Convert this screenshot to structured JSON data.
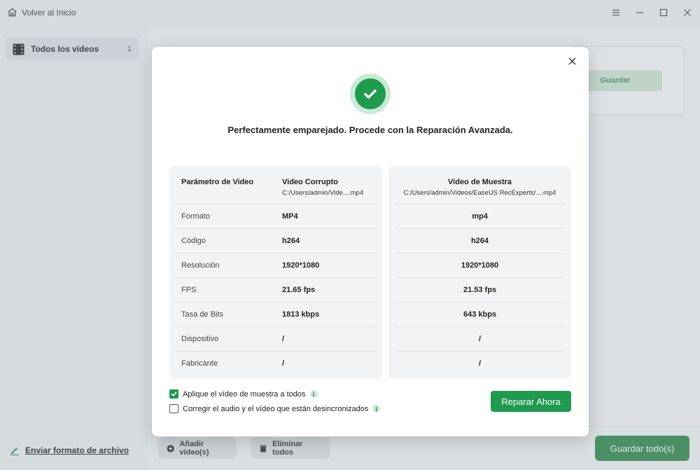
{
  "titlebar": {
    "home_label": "Volver al Inicio",
    "icons": [
      "home-icon",
      "menu-icon",
      "minimize-icon",
      "maximize-icon",
      "close-icon"
    ]
  },
  "sidebar": {
    "items": [
      {
        "label": "Todos los vídeos",
        "count": "1",
        "icon": "film-icon"
      }
    ],
    "feedback_label": "Enviar formato de archivo"
  },
  "main": {
    "save_label": "Guardar"
  },
  "bottom": {
    "add_label": "Añadir vídeo(s)",
    "delete_label": "Eliminar todos",
    "save_all_label": "Guardar todo(s)"
  },
  "modal": {
    "headline": "Perfectamente emparejado. Procede con la Reparación Avanzada.",
    "left_header": {
      "param_title": "Parámetro de Video",
      "col_title": "Video Corrupto",
      "col_path": "C:/Users/admin/Vide....mp4"
    },
    "right_header": {
      "col_title": "Video de Muestra",
      "col_path": "C:/Users/admin/Videos/EaseUS RecExperts/....mp4"
    },
    "rows": [
      {
        "param": "Formato",
        "corrupt": "MP4",
        "sample": "mp4"
      },
      {
        "param": "Código",
        "corrupt": "h264",
        "sample": "h264"
      },
      {
        "param": "Resolución",
        "corrupt": "1920*1080",
        "sample": "1920*1080"
      },
      {
        "param": "FPS",
        "corrupt": "21.65 fps",
        "sample": "21.53 fps"
      },
      {
        "param": "Tasa de Bits",
        "corrupt": "1813 kbps",
        "sample": "643 kbps"
      },
      {
        "param": "Dispositivo",
        "corrupt": "/",
        "sample": "/"
      },
      {
        "param": "Fabricante",
        "corrupt": "/",
        "sample": "/"
      }
    ],
    "options": [
      {
        "label": "Aplique el vídeo de muestra a todos",
        "checked": true
      },
      {
        "label": "Corregir el audio y el vídeo que están desincronizados",
        "checked": false
      }
    ],
    "repair_label": "Reparar Ahora"
  },
  "colors": {
    "accent": "#1f9a4f",
    "save_all": "#2f8a4c"
  }
}
